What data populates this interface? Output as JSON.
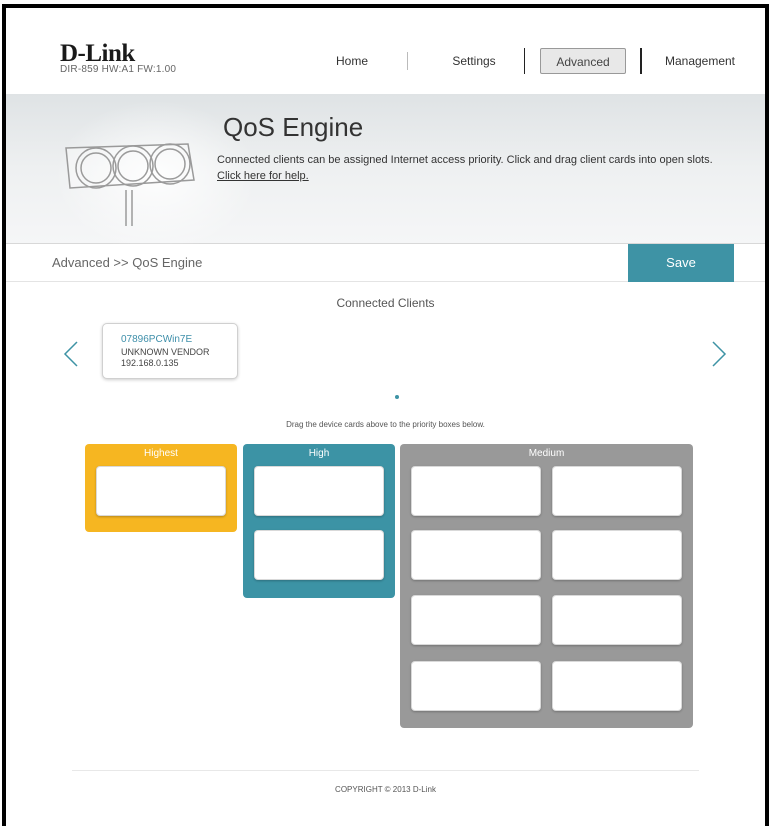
{
  "header": {
    "logo": "D-Link",
    "model_info": "DIR-859   HW:A1   FW:1.00",
    "nav": {
      "home": "Home",
      "settings": "Settings",
      "advanced": "Advanced",
      "management": "Management"
    }
  },
  "banner": {
    "title": "QoS Engine",
    "description": "Connected clients can be assigned Internet access priority. Click and drag client cards into open slots.",
    "help_link": "Click here for help."
  },
  "breadcrumb": "Advanced >> QoS Engine",
  "save_label": "Save",
  "clients": {
    "title": "Connected Clients",
    "cards": [
      {
        "name": "07896PCWin7E",
        "vendor": "UNKNOWN VENDOR",
        "ip": "192.168.0.135"
      }
    ],
    "prev_icon": "chevron-left-icon",
    "next_icon": "chevron-right-icon"
  },
  "drag_hint": "Drag the device cards above to the priority boxes below.",
  "priorities": {
    "highest": {
      "label": "Highest",
      "slots": 1,
      "color": "#f6b621"
    },
    "high": {
      "label": "High",
      "slots": 2,
      "color": "#3c93a5"
    },
    "medium": {
      "label": "Medium",
      "slots": 8,
      "color": "#999999"
    }
  },
  "footer": {
    "copyright": "COPYRIGHT © 2013 D-Link"
  },
  "colors": {
    "accent": "#3e93a5",
    "link": "#3e8faa"
  }
}
